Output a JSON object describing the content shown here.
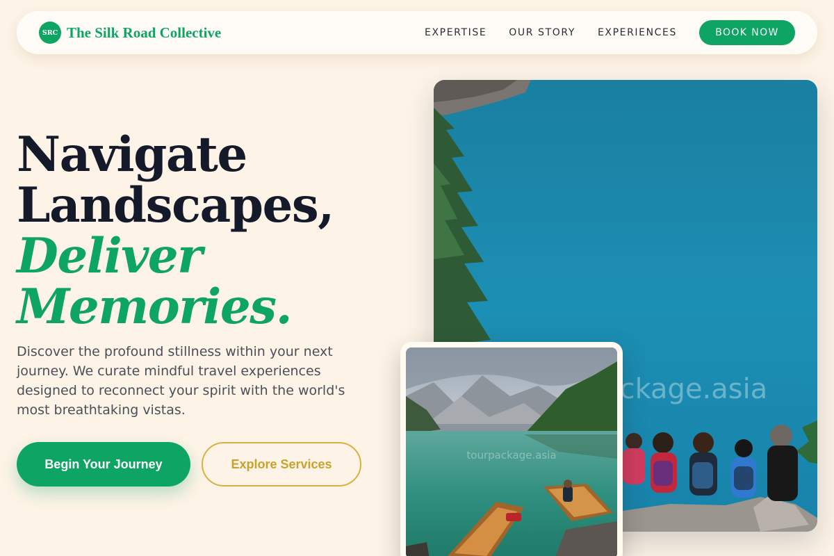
{
  "nav": {
    "logo_text": "SRC",
    "brand": "The Silk Road Collective",
    "links": [
      "EXPERTISE",
      "OUR STORY",
      "EXPERIENCES"
    ],
    "cta": "BOOK NOW"
  },
  "hero": {
    "headline_lines": [
      "Navigate",
      "Landscapes,"
    ],
    "headline_accent_lines": [
      "Deliver",
      "Memories."
    ],
    "description": "Discover the profound stillness within your next journey. We curate mindful travel experiences designed to reconnect your spirit with the world's most breathtaking vistas.",
    "primary_cta": "Begin Your Journey",
    "secondary_cta": "Explore Services"
  },
  "images": {
    "main_watermark": "tourpackage.asia",
    "secondary_watermark": "tourpackage.asia"
  },
  "colors": {
    "background": "#fdf3e6",
    "accent_green": "#0ea463",
    "accent_gold": "#d8b23e",
    "heading": "#151a2b"
  }
}
